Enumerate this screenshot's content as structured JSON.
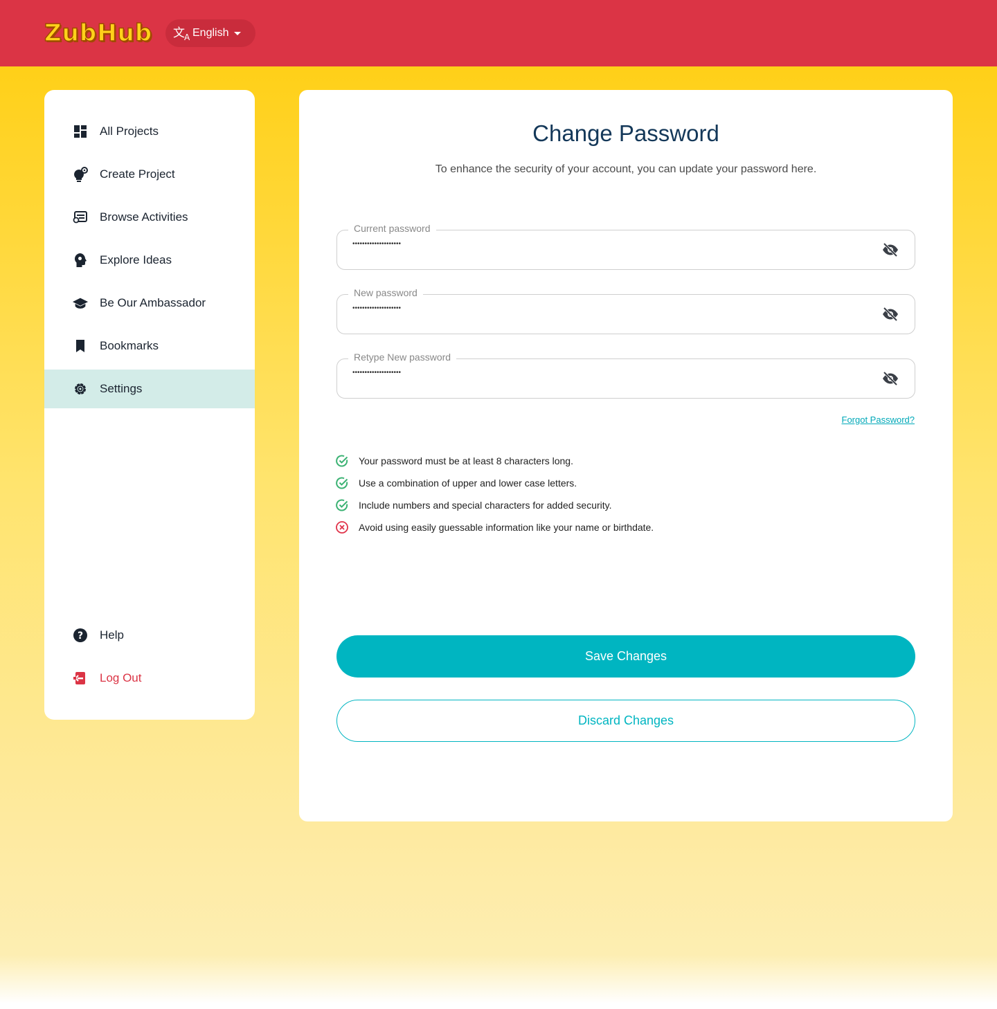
{
  "header": {
    "logo_text": "ZubHub",
    "language": {
      "label": "English",
      "icon": "translate-icon"
    },
    "brand_color": "#db3445"
  },
  "sidebar": {
    "items": [
      {
        "label": "All Projects",
        "icon": "dashboard-icon"
      },
      {
        "label": "Create Project",
        "icon": "lightbulb-gear-icon"
      },
      {
        "label": "Browse Activities",
        "icon": "activities-icon"
      },
      {
        "label": "Explore Ideas",
        "icon": "idea-head-icon"
      },
      {
        "label": "Be Our Ambassador",
        "icon": "graduation-cap-icon"
      },
      {
        "label": "Bookmarks",
        "icon": "bookmark-icon"
      },
      {
        "label": "Settings",
        "icon": "gear-icon",
        "active": true
      }
    ],
    "bottom_items": [
      {
        "label": "Help",
        "icon": "help-icon"
      },
      {
        "label": "Log Out",
        "icon": "logout-icon",
        "color": "#db3445"
      }
    ],
    "active_bg": "#d3ece8"
  },
  "main": {
    "title": "Change Password",
    "subtitle": "To enhance the security of your account, you can update your password here.",
    "fields": [
      {
        "label": "Current password",
        "value": "••••••••••••••••••••"
      },
      {
        "label": "New password",
        "value": "••••••••••••••••••••"
      },
      {
        "label": "Retype New password",
        "value": "••••••••••••••••••••"
      }
    ],
    "forgot_link": "Forgot Password?",
    "rules": [
      {
        "text": "Your password must be at least 8 characters long.",
        "status": "pass"
      },
      {
        "text": "Use a combination of upper and lower case letters.",
        "status": "pass"
      },
      {
        "text": "Include numbers and special characters for added security.",
        "status": "pass"
      },
      {
        "text": "Avoid using easily guessable information like your name or birthdate.",
        "status": "fail"
      }
    ],
    "save_label": "Save Changes",
    "discard_label": "Discard Changes",
    "accent_color": "#00b5c1",
    "pass_color": "#3bb273",
    "fail_color": "#e0334a"
  }
}
